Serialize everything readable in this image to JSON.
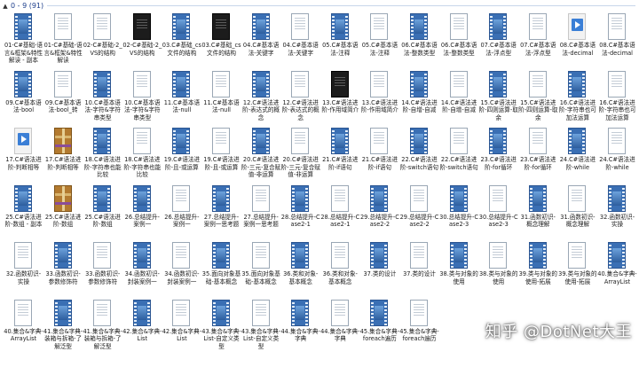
{
  "group_header": {
    "title": "0 - 9 (91)"
  },
  "watermark": {
    "text": "知乎 @DotNet大王"
  },
  "items": [
    {
      "label": "01-C#基础-语言&框架&特性解读 - 副本",
      "type": "video"
    },
    {
      "label": "01-C#基础-语言&框架&特性解读",
      "type": "doc"
    },
    {
      "label": "02-C#基础-2_VS的结构",
      "type": "doc"
    },
    {
      "label": "02-C#基础-2_VS的结构",
      "type": "dark"
    },
    {
      "label": "03.C#基础_cs文件的结构",
      "type": "video"
    },
    {
      "label": "03.C#基础_cs文件的结构",
      "type": "dark"
    },
    {
      "label": "04.C#基本语法-关键字",
      "type": "video"
    },
    {
      "label": "04.C#基本语法-关键字",
      "type": "doc"
    },
    {
      "label": "05.C#基本语法-注释",
      "type": "video"
    },
    {
      "label": "05.C#基本语法-注释",
      "type": "doc"
    },
    {
      "label": "06.C#基本语法-整数类型",
      "type": "video"
    },
    {
      "label": "06.C#基本语法-整数类型",
      "type": "doc"
    },
    {
      "label": "07.C#基本语法-浮点型",
      "type": "video"
    },
    {
      "label": "07.C#基本语法-浮点型",
      "type": "doc"
    },
    {
      "label": "08.C#基本语法-decimal",
      "type": "player"
    },
    {
      "label": "08.C#基本语法-decimal",
      "type": "doc"
    },
    {
      "label": "09.C#基本语法-bool",
      "type": "video"
    },
    {
      "label": "09.C#基本语法-bool_转",
      "type": "doc"
    },
    {
      "label": "10.C#基本语法-字符&字符串类型",
      "type": "video"
    },
    {
      "label": "10.C#基本语法-字符&字符串类型",
      "type": "doc"
    },
    {
      "label": "11.C#基本语法-null",
      "type": "video"
    },
    {
      "label": "11.C#基本语法-null",
      "type": "doc"
    },
    {
      "label": "12.C#语法进阶-表达式的概念",
      "type": "video"
    },
    {
      "label": "12.C#语法进阶-表达式的概念",
      "type": "doc"
    },
    {
      "label": "13.C#语法进阶-作用域简介",
      "type": "dark"
    },
    {
      "label": "13.C#语法进阶-作用域简介",
      "type": "doc"
    },
    {
      "label": "14.C#语法进阶-自增-自减",
      "type": "video"
    },
    {
      "label": "14.C#语法进阶-自增-自减",
      "type": "doc"
    },
    {
      "label": "15.C#语法进阶-四则运算-取余",
      "type": "video"
    },
    {
      "label": "15.C#语法进阶-四则运算-取余",
      "type": "doc"
    },
    {
      "label": "16.C#语法进阶-字符串也可加法运算",
      "type": "video"
    },
    {
      "label": "16.C#语法进阶-字符串也可加法运算",
      "type": "doc"
    },
    {
      "label": "17.C#语法进阶-判断相等",
      "type": "player"
    },
    {
      "label": "17.C#语法进阶-判断相等",
      "type": "archive"
    },
    {
      "label": "18.C#语法进阶-字符串也能比较",
      "type": "video"
    },
    {
      "label": "18.C#语法进阶-字符串也能比较",
      "type": "doc"
    },
    {
      "label": "19.C#语法进阶-且-或运算",
      "type": "video"
    },
    {
      "label": "19.C#语法进阶-且-或运算",
      "type": "doc"
    },
    {
      "label": "20.C#语法进阶-三元-复合赋值-非运算",
      "type": "video"
    },
    {
      "label": "20.C#语法进阶-三元-复合赋值-非运算",
      "type": "doc"
    },
    {
      "label": "21.C#语法进阶-if语句",
      "type": "video"
    },
    {
      "label": "21.C#语法进阶-if语句",
      "type": "doc"
    },
    {
      "label": "22.C#语法进阶-switch语句",
      "type": "video"
    },
    {
      "label": "22.C#语法进阶-switch语句",
      "type": "doc"
    },
    {
      "label": "23.C#语法进阶-for循环",
      "type": "video"
    },
    {
      "label": "23.C#语法进阶-for循环",
      "type": "doc"
    },
    {
      "label": "24.C#语法进阶-while",
      "type": "video"
    },
    {
      "label": "24.C#语法进阶-while",
      "type": "doc"
    },
    {
      "label": "25.C#语法进阶-数组 - 副本",
      "type": "video"
    },
    {
      "label": "25.C#语法进阶-数组",
      "type": "archive"
    },
    {
      "label": "25.C#语法进阶-数组",
      "type": "video"
    },
    {
      "label": "26.总结提升-案例一",
      "type": "video"
    },
    {
      "label": "26.总结提升-案例一",
      "type": "doc"
    },
    {
      "label": "27.总结提升-案例一思考题",
      "type": "video"
    },
    {
      "label": "27.总结提升-案例一思考题",
      "type": "doc"
    },
    {
      "label": "28.总结提升-Case2-1",
      "type": "video"
    },
    {
      "label": "28.总结提升-Case2-1",
      "type": "doc"
    },
    {
      "label": "29.总结提升-Case2-2",
      "type": "video"
    },
    {
      "label": "29.总结提升-Case2-2",
      "type": "doc"
    },
    {
      "label": "30.总结提升-Case2-3",
      "type": "video"
    },
    {
      "label": "30.总结提升-Case2-3",
      "type": "doc"
    },
    {
      "label": "31.函数初识-概念理解",
      "type": "video"
    },
    {
      "label": "31.函数初识-概念理解",
      "type": "doc"
    },
    {
      "label": "32.函数初识-实操",
      "type": "video"
    },
    {
      "label": "32.函数初识-实操",
      "type": "doc"
    },
    {
      "label": "33.函数初识-参数修饰符",
      "type": "video"
    },
    {
      "label": "33.函数初识-参数修饰符",
      "type": "doc"
    },
    {
      "label": "34.函数初识-封装案例一",
      "type": "video"
    },
    {
      "label": "34.函数初识-封装案例一",
      "type": "doc"
    },
    {
      "label": "35.面向对象基础-基本概念",
      "type": "video"
    },
    {
      "label": "35.面向对象基础-基本概念",
      "type": "doc"
    },
    {
      "label": "36.类和对象-基本概念",
      "type": "video"
    },
    {
      "label": "36.类和对象-基本概念",
      "type": "doc"
    },
    {
      "label": "37.类的设计",
      "type": "video"
    },
    {
      "label": "37.类的设计",
      "type": "doc"
    },
    {
      "label": "38.类与对象的使用",
      "type": "video"
    },
    {
      "label": "38.类与对象的使用",
      "type": "doc"
    },
    {
      "label": "39.类与对象的使用-拓展",
      "type": "video"
    },
    {
      "label": "39.类与对象的使用-拓展",
      "type": "doc"
    },
    {
      "label": "40.集合&字典-ArrayList",
      "type": "video"
    },
    {
      "label": "40.集合&字典-ArrayList",
      "type": "doc"
    },
    {
      "label": "41.集合&字典-装箱与拆箱-了解泛型",
      "type": "video"
    },
    {
      "label": "41.集合&字典-装箱与拆箱-了解泛型",
      "type": "doc"
    },
    {
      "label": "42.集合&字典-List",
      "type": "video"
    },
    {
      "label": "42.集合&字典-List",
      "type": "doc"
    },
    {
      "label": "43.集合&字典-List-自定义类型",
      "type": "video"
    },
    {
      "label": "43.集合&字典-List-自定义类型",
      "type": "doc"
    },
    {
      "label": "44.集合&字典-字典",
      "type": "video"
    },
    {
      "label": "44.集合&字典-字典",
      "type": "doc"
    },
    {
      "label": "45.集合&字典-foreach遍历",
      "type": "video"
    },
    {
      "label": "45.集合&字典-foreach遍历",
      "type": "doc"
    }
  ]
}
